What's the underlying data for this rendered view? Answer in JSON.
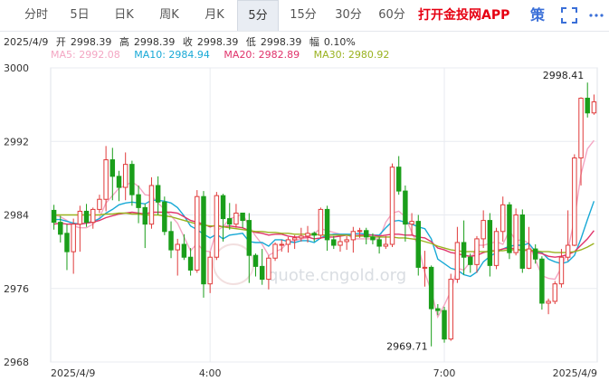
{
  "tabs": [
    {
      "label": "分时",
      "active": false
    },
    {
      "label": "5日",
      "active": false
    },
    {
      "label": "日K",
      "active": false
    },
    {
      "label": "周K",
      "active": false
    },
    {
      "label": "月K",
      "active": false
    },
    {
      "label": "5分",
      "active": true
    },
    {
      "label": "15分",
      "active": false
    },
    {
      "label": "30分",
      "active": false
    },
    {
      "label": "60分",
      "active": false
    }
  ],
  "promo_label": "打开金投网APP",
  "strategy_label": "策",
  "icons": {
    "fullscreen": "fullscreen-icon",
    "more": "more-icon"
  },
  "info": {
    "date": "2025/4/9",
    "open_label": "开",
    "open": "2998.39",
    "high_label": "高",
    "high": "2998.39",
    "close_label": "收",
    "close": "2998.39",
    "low_label": "低",
    "low": "2998.39",
    "amp_label": "幅",
    "amp": "0.10%"
  },
  "ma": [
    {
      "label": "MA5: 2992.08",
      "color": "#f4a6c3"
    },
    {
      "label": "MA10: 2984.94",
      "color": "#18a9d6"
    },
    {
      "label": "MA20: 2982.89",
      "color": "#e0336b"
    },
    {
      "label": "MA30: 2980.92",
      "color": "#9ab21f"
    }
  ],
  "watermark": "quote.cngold.org",
  "colors": {
    "up": "#e03b3b",
    "down": "#1a9e1a",
    "grid": "#e8ebf0",
    "axis_text": "#333333"
  },
  "chart_data": {
    "type": "candlestick",
    "ylim": [
      2968,
      3000
    ],
    "y_ticks": [
      3000,
      2992,
      2984,
      2976,
      2968
    ],
    "x_tick_labels": [
      {
        "label": "2025/4/9",
        "index": 0
      },
      {
        "label": "4:00",
        "index": 24
      },
      {
        "label": "7:00",
        "index": 60
      },
      {
        "label": "2025/4/9",
        "index": 83
      }
    ],
    "annotations": [
      {
        "label": "2998.41",
        "index": 82,
        "value": 2998.41
      },
      {
        "label": "2969.71",
        "index": 58,
        "value": 2969.71
      }
    ],
    "candles": [
      [
        2984.5,
        2983.2,
        2985.1,
        2982.4
      ],
      [
        2983.2,
        2981.9,
        2983.9,
        2981.0
      ],
      [
        2982.0,
        2980.0,
        2983.0,
        2978.0
      ],
      [
        2980.0,
        2983.0,
        2983.6,
        2977.6
      ],
      [
        2983.0,
        2984.4,
        2985.0,
        2980.0
      ],
      [
        2984.4,
        2983.2,
        2985.2,
        2982.7
      ],
      [
        2983.2,
        2984.6,
        2984.8,
        2982.5
      ],
      [
        2984.6,
        2985.7,
        2986.2,
        2984.2
      ],
      [
        2985.7,
        2990.0,
        2991.5,
        2984.4
      ],
      [
        2990.0,
        2988.2,
        2991.3,
        2985.6
      ],
      [
        2988.2,
        2987.0,
        2988.8,
        2985.5
      ],
      [
        2987.0,
        2989.5,
        2990.8,
        2985.6
      ],
      [
        2989.5,
        2986.2,
        2989.9,
        2985.0
      ],
      [
        2986.2,
        2984.8,
        2987.2,
        2983.1
      ],
      [
        2984.8,
        2983.0,
        2985.2,
        2980.4
      ],
      [
        2983.0,
        2987.2,
        2988.1,
        2982.5
      ],
      [
        2987.2,
        2985.4,
        2988.2,
        2984.0
      ],
      [
        2985.4,
        2982.2,
        2986.0,
        2981.8
      ],
      [
        2982.2,
        2980.2,
        2983.3,
        2979.3
      ],
      [
        2980.2,
        2980.8,
        2981.4,
        2977.4
      ],
      [
        2980.8,
        2979.4,
        2981.9,
        2979.1
      ],
      [
        2979.4,
        2978.0,
        2980.4,
        2977.4
      ],
      [
        2978.0,
        2986.0,
        2986.7,
        2977.7
      ],
      [
        2986.0,
        2976.5,
        2986.6,
        2975.0
      ],
      [
        2976.5,
        2979.4,
        2980.0,
        2975.5
      ],
      [
        2979.4,
        2986.1,
        2986.5,
        2979.1
      ],
      [
        2986.1,
        2983.6,
        2986.3,
        2981.1
      ],
      [
        2983.6,
        2983.0,
        2985.3,
        2982.4
      ],
      [
        2983.0,
        2984.2,
        2985.2,
        2982.6
      ],
      [
        2984.2,
        2983.4,
        2984.2,
        2982.6
      ],
      [
        2983.4,
        2979.6,
        2984.2,
        2976.6
      ],
      [
        2979.6,
        2978.4,
        2979.8,
        2977.3
      ],
      [
        2978.4,
        2977.0,
        2980.3,
        2976.4
      ],
      [
        2977.0,
        2979.3,
        2979.6,
        2975.9
      ],
      [
        2979.3,
        2980.8,
        2981.0,
        2979.0
      ],
      [
        2980.8,
        2980.8,
        2981.3,
        2980.0
      ],
      [
        2980.8,
        2981.3,
        2981.6,
        2979.9
      ],
      [
        2981.3,
        2981.5,
        2981.8,
        2980.3
      ],
      [
        2981.5,
        2981.7,
        2982.6,
        2981.1
      ],
      [
        2981.7,
        2982.0,
        2982.8,
        2981.0
      ],
      [
        2982.0,
        2981.8,
        2982.2,
        2981.1
      ],
      [
        2981.8,
        2984.6,
        2984.8,
        2981.4
      ],
      [
        2984.6,
        2981.3,
        2985.0,
        2980.1
      ],
      [
        2981.3,
        2980.7,
        2981.7,
        2980.3
      ],
      [
        2980.7,
        2981.1,
        2981.7,
        2980.0
      ],
      [
        2981.1,
        2981.3,
        2981.7,
        2980.2
      ],
      [
        2981.3,
        2982.2,
        2982.7,
        2979.9
      ],
      [
        2982.2,
        2982.3,
        2982.6,
        2981.5
      ],
      [
        2982.3,
        2981.6,
        2982.6,
        2980.8
      ],
      [
        2981.6,
        2981.3,
        2982.0,
        2980.8
      ],
      [
        2981.3,
        2980.6,
        2981.6,
        2979.8
      ],
      [
        2980.6,
        2980.8,
        2981.7,
        2980.3
      ],
      [
        2980.8,
        2989.2,
        2989.6,
        2980.5
      ],
      [
        2989.2,
        2986.6,
        2990.4,
        2986.2
      ],
      [
        2986.6,
        2983.0,
        2987.2,
        2981.1
      ],
      [
        2983.0,
        2983.3,
        2984.2,
        2981.8
      ],
      [
        2983.3,
        2978.3,
        2984.0,
        2977.4
      ],
      [
        2978.3,
        2978.3,
        2980.1,
        2976.2
      ],
      [
        2978.3,
        2973.8,
        2978.5,
        2969.7
      ],
      [
        2973.8,
        2973.6,
        2974.3,
        2973.1
      ],
      [
        2973.6,
        2970.5,
        2974.0,
        2970.1
      ],
      [
        2970.5,
        2977.0,
        2977.6,
        2970.3
      ],
      [
        2977.0,
        2981.0,
        2982.7,
        2976.6
      ],
      [
        2981.0,
        2979.4,
        2983.4,
        2977.5
      ],
      [
        2979.4,
        2978.6,
        2979.8,
        2977.7
      ],
      [
        2978.6,
        2981.4,
        2981.7,
        2977.7
      ],
      [
        2981.4,
        2983.4,
        2984.5,
        2980.4
      ],
      [
        2983.4,
        2978.5,
        2984.2,
        2977.3
      ],
      [
        2978.5,
        2982.2,
        2982.6,
        2978.1
      ],
      [
        2982.2,
        2985.1,
        2986.0,
        2981.1
      ],
      [
        2985.1,
        2979.9,
        2985.4,
        2979.2
      ],
      [
        2979.9,
        2984.0,
        2984.7,
        2979.6
      ],
      [
        2984.0,
        2978.2,
        2984.6,
        2977.7
      ],
      [
        2978.2,
        2980.3,
        2982.7,
        2978.1
      ],
      [
        2980.3,
        2979.2,
        2980.8,
        2978.7
      ],
      [
        2979.2,
        2974.4,
        2979.5,
        2973.7
      ],
      [
        2974.4,
        2974.6,
        2974.9,
        2973.2
      ],
      [
        2974.6,
        2976.5,
        2976.8,
        2974.3
      ],
      [
        2976.5,
        2979.4,
        2980.3,
        2976.1
      ],
      [
        2979.4,
        2980.7,
        2984.5,
        2979.0
      ],
      [
        2980.7,
        2990.2,
        2990.6,
        2980.6
      ],
      [
        2990.2,
        2996.7,
        2996.8,
        2987.2
      ],
      [
        2996.7,
        2995.1,
        2998.4,
        2994.6
      ],
      [
        2995.1,
        2996.3,
        2997.1,
        2994.9
      ]
    ],
    "series": [
      {
        "name": "MA5",
        "color": "#f4a6c3",
        "values": [
          2984.0,
          2983.8,
          2983.4,
          2982.8,
          2982.6,
          2982.6,
          2983.0,
          2983.7,
          2985.3,
          2986.1,
          2986.9,
          2987.2,
          2987.6,
          2987.1,
          2986.2,
          2986.1,
          2985.3,
          2984.6,
          2983.9,
          2983.1,
          2981.6,
          2980.1,
          2980.9,
          2980.1,
          2980.0,
          2982.3,
          2982.7,
          2983.6,
          2983.8,
          2984.1,
          2982.8,
          2981.7,
          2980.8,
          2979.6,
          2980.0,
          2980.3,
          2981.1,
          2981.2,
          2981.4,
          2981.5,
          2982.0,
          2982.5,
          2982.3,
          2982.1,
          2981.9,
          2981.9,
          2981.4,
          2981.4,
          2981.4,
          2981.4,
          2981.4,
          2983.2,
          2984.2,
          2984.4,
          2983.8,
          2982.1,
          2980.6,
          2977.7,
          2975.7,
          2972.9,
          2974.2,
          2975.7,
          2978.2,
          2978.0,
          2978.9,
          2980.7,
          2980.7,
          2980.9,
          2981.1,
          2980.8,
          2982.3,
          2981.2,
          2981.3,
          2980.9,
          2979.1,
          2977.4,
          2977.1,
          2977.0,
          2978.3,
          2980.2,
          2983.5,
          2988.4,
          2991.2,
          2992.1
        ]
      },
      {
        "name": "MA10",
        "color": "#18a9d6",
        "values": [
          2983.5,
          2983.5,
          2983.3,
          2983.1,
          2983.0,
          2983.1,
          2983.3,
          2983.6,
          2984.2,
          2984.6,
          2985.1,
          2985.3,
          2985.4,
          2985.3,
          2985.2,
          2985.6,
          2985.6,
          2985.5,
          2985.3,
          2984.8,
          2983.9,
          2982.8,
          2982.4,
          2981.9,
          2981.5,
          2981.9,
          2981.4,
          2981.8,
          2981.9,
          2982.0,
          2981.1,
          2981.0,
          2981.0,
          2980.6,
          2981.3,
          2981.3,
          2981.1,
          2981.0,
          2981.2,
          2981.2,
          2981.0,
          2981.5,
          2981.8,
          2981.9,
          2981.9,
          2981.9,
          2981.9,
          2982.0,
          2981.9,
          2981.8,
          2981.8,
          2982.6,
          2983.3,
          2983.4,
          2983.2,
          2983.0,
          2982.7,
          2982.5,
          2981.4,
          2979.2,
          2978.7,
          2978.2,
          2978.0,
          2977.5,
          2977.3,
          2977.8,
          2978.9,
          2979.5,
          2979.9,
          2980.3,
          2980.6,
          2980.7,
          2980.7,
          2980.9,
          2980.0,
          2979.9,
          2979.2,
          2978.9,
          2978.7,
          2978.9,
          2979.6,
          2981.4,
          2983.5,
          2985.5
        ]
      },
      {
        "name": "MA20",
        "color": "#e0336b",
        "values": [
          2983.0,
          2983.1,
          2983.0,
          2983.0,
          2983.0,
          2983.1,
          2983.2,
          2983.4,
          2983.7,
          2983.9,
          2984.1,
          2984.2,
          2984.3,
          2984.2,
          2984.1,
          2984.3,
          2984.3,
          2984.3,
          2984.3,
          2984.2,
          2983.8,
          2983.4,
          2983.2,
          2983.0,
          2982.7,
          2982.9,
          2982.7,
          2982.8,
          2982.7,
          2982.6,
          2982.3,
          2982.1,
          2982.0,
          2981.8,
          2981.9,
          2981.9,
          2981.7,
          2981.6,
          2981.6,
          2981.6,
          2981.4,
          2981.5,
          2981.6,
          2981.6,
          2981.7,
          2981.8,
          2981.7,
          2981.8,
          2981.8,
          2981.8,
          2981.7,
          2981.8,
          2981.9,
          2981.9,
          2981.8,
          2981.8,
          2981.6,
          2981.5,
          2981.1,
          2980.4,
          2980.2,
          2979.9,
          2979.8,
          2979.6,
          2979.5,
          2979.6,
          2979.9,
          2980.1,
          2980.1,
          2980.3,
          2980.4,
          2980.3,
          2980.1,
          2980.2,
          2979.9,
          2979.8,
          2979.5,
          2979.4,
          2979.5,
          2979.7,
          2980.0,
          2980.7,
          2981.4,
          2982.3
        ]
      },
      {
        "name": "MA30",
        "color": "#9ab21f",
        "values": [
          2984.0,
          2984.0,
          2984.0,
          2984.0,
          2984.0,
          2984.0,
          2984.0,
          2984.0,
          2984.1,
          2984.1,
          2984.2,
          2984.2,
          2984.1,
          2984.1,
          2984.0,
          2984.0,
          2984.0,
          2983.9,
          2983.8,
          2983.6,
          2983.4,
          2983.2,
          2983.0,
          2982.9,
          2982.8,
          2982.8,
          2982.7,
          2982.6,
          2982.5,
          2982.4,
          2982.3,
          2982.2,
          2982.2,
          2982.1,
          2982.1,
          2982.0,
          2982.0,
          2981.9,
          2981.9,
          2981.9,
          2981.9,
          2981.8,
          2981.8,
          2981.8,
          2981.8,
          2981.8,
          2981.7,
          2981.7,
          2981.7,
          2981.6,
          2981.6,
          2981.6,
          2981.6,
          2981.5,
          2981.5,
          2981.4,
          2981.3,
          2981.1,
          2980.9,
          2980.6,
          2980.4,
          2980.2,
          2980.1,
          2980.0,
          2980.0,
          2980.0,
          2980.0,
          2980.0,
          2980.1,
          2980.1,
          2980.2,
          2980.2,
          2980.2,
          2980.2,
          2980.1,
          2980.0,
          2980.0,
          2979.9,
          2979.9,
          2979.9,
          2980.0,
          2980.2,
          2980.5,
          2980.9
        ]
      }
    ]
  }
}
